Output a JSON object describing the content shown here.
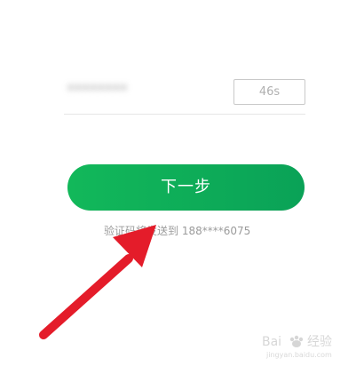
{
  "verification": {
    "code_value": "********",
    "countdown_label": "46s"
  },
  "actions": {
    "next_label": "下一步"
  },
  "hint": {
    "sent_message": "验证码将发送到 188****6075"
  },
  "watermark": {
    "site": "jingyan.baidu.com",
    "logo_text": "Bai 经验"
  },
  "annotation": {
    "arrow_color": "#e41c2a"
  },
  "colors": {
    "accent": "#12b85a",
    "muted_text": "#9b9b9b"
  }
}
